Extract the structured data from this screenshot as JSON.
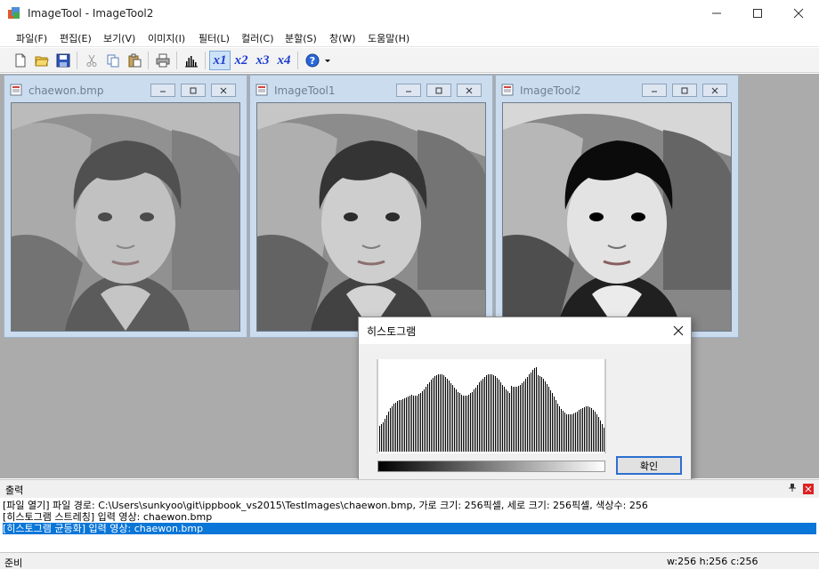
{
  "window": {
    "title": "ImageTool - ImageTool2"
  },
  "menu": [
    "파일(F)",
    "편집(E)",
    "보기(V)",
    "이미지(I)",
    "필터(L)",
    "컬러(C)",
    "분할(S)",
    "창(W)",
    "도움말(H)"
  ],
  "toolbar": {
    "icons": [
      "new-file-icon",
      "open-folder-icon",
      "save-icon",
      "cut-icon",
      "copy-icon",
      "paste-icon",
      "print-icon",
      "histogram-icon",
      "help-icon"
    ],
    "zoom": [
      "x1",
      "x2",
      "x3",
      "x4"
    ],
    "active_zoom": "x1"
  },
  "children": [
    {
      "title": "chaewon.bmp",
      "variant": "original"
    },
    {
      "title": "ImageTool1",
      "variant": "stretched"
    },
    {
      "title": "ImageTool2",
      "variant": "equalized"
    }
  ],
  "histogram_dialog": {
    "title": "히스토그램",
    "ok_label": "확인"
  },
  "output": {
    "title": "출력",
    "lines": [
      "[파일 열기] 파일 경로: C:\\Users\\sunkyoo\\git\\ippbook_vs2015\\TestImages\\chaewon.bmp, 가로 크기: 256픽셀, 세로 크기: 256픽셀, 색상수: 256",
      "[히스토그램 스트레칭] 입력 영상: chaewon.bmp",
      "[히스토그램 균등화] 입력 영상: chaewon.bmp"
    ],
    "selected_line": 2
  },
  "status": {
    "text": "준비",
    "dims": "w:256  h:256  c:256"
  },
  "colors": {
    "accent": "#0a76d8",
    "mdi_background": "#ababab",
    "child_frame": "#cbdcef",
    "zoom_text": "#1f3fd0"
  }
}
